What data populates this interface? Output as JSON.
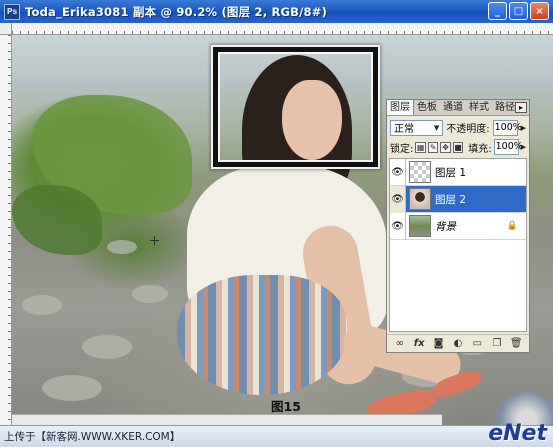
{
  "window": {
    "title": "Toda_Erika3081 副本 @ 90.2% (图层 2, RGB/8#)",
    "logo": "Ps",
    "controls": {
      "minimize": "_",
      "maximize": "□",
      "close": "×"
    }
  },
  "canvas": {
    "figure_caption": "图15"
  },
  "layers_panel": {
    "tabs": [
      "图层",
      "色板",
      "通道",
      "样式",
      "路径"
    ],
    "blend_mode": "正常",
    "opacity_label": "不透明度:",
    "opacity_value": "100%",
    "lock_label": "锁定:",
    "fill_label": "填充:",
    "fill_value": "100%",
    "layers": [
      {
        "name": "图层 1",
        "selected": false,
        "thumbnail": "transparent"
      },
      {
        "name": "图层 2",
        "selected": true,
        "thumbnail": "portrait"
      },
      {
        "name": "背景",
        "selected": false,
        "thumbnail": "photo",
        "locked": true
      }
    ],
    "bottom_icons": [
      "link-icon",
      "fx-icon",
      "mask-icon",
      "adjustment-icon",
      "folder-icon",
      "new-layer-icon",
      "trash-icon"
    ]
  },
  "status_bar": {
    "text": "上传于【新客网.WWW.XKER.COM】"
  },
  "watermark": {
    "logo_text": "eNet"
  }
}
